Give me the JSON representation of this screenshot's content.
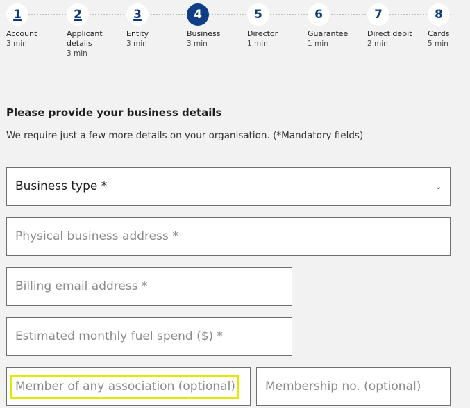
{
  "steps": [
    {
      "num": "1",
      "label": "Account",
      "label2": "",
      "time": "3 min",
      "state": "done"
    },
    {
      "num": "2",
      "label": "Applicant",
      "label2": "details",
      "time": "3 min",
      "state": "done"
    },
    {
      "num": "3",
      "label": "Entity",
      "label2": "",
      "time": "3 min",
      "state": "done"
    },
    {
      "num": "4",
      "label": "Business",
      "label2": "",
      "time": "3 min",
      "state": "active"
    },
    {
      "num": "5",
      "label": "Director",
      "label2": "",
      "time": "1 min",
      "state": "todo"
    },
    {
      "num": "6",
      "label": "Guarantee",
      "label2": "",
      "time": "1 min",
      "state": "todo"
    },
    {
      "num": "7",
      "label": "Direct debit",
      "label2": "",
      "time": "2 min",
      "state": "todo"
    },
    {
      "num": "8",
      "label": "Cards",
      "label2": "",
      "time": "5 min",
      "state": "todo"
    }
  ],
  "form": {
    "heading": "Please provide your business details",
    "subtext": "We require just a few more details on your organisation. (*Mandatory fields)",
    "business_type": "Business type *",
    "physical_address": "Physical business address *",
    "billing_email": "Billing email address *",
    "fuel_spend": "Estimated monthly fuel spend ($) *",
    "association": "Member of any association (optional)",
    "membership_no": "Membership no. (optional)"
  },
  "colors": {
    "active_step": "#0f3e86",
    "highlight": "#e6e600"
  }
}
